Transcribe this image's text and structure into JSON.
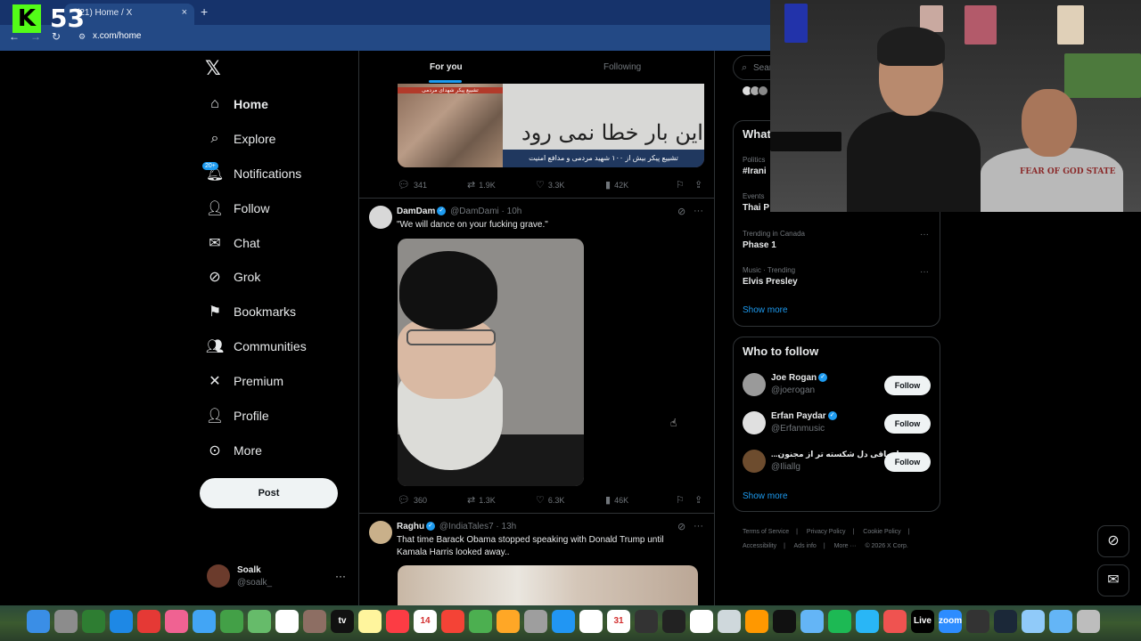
{
  "browser": {
    "tab_title": "(21) Home / X",
    "close": "×",
    "new_tab": "+",
    "url": "x.com/home",
    "back": "←",
    "forward": "→",
    "reload": "↻",
    "site_icon": "⚙"
  },
  "overlay": {
    "kick_logo": "K",
    "viewer_count": "53"
  },
  "sidebar": {
    "logo": "𝕏",
    "items": [
      {
        "label": "Home",
        "icon": "home-icon",
        "glyph": "⌂"
      },
      {
        "label": "Explore",
        "icon": "search-icon",
        "glyph": "⌕"
      },
      {
        "label": "Notifications",
        "icon": "bell-icon",
        "glyph": "🔔︎"
      },
      {
        "label": "Follow",
        "icon": "add-user-icon",
        "glyph": "👤︎"
      },
      {
        "label": "Chat",
        "icon": "mail-icon",
        "glyph": "✉"
      },
      {
        "label": "Grok",
        "icon": "grok-icon",
        "glyph": "⊘"
      },
      {
        "label": "Bookmarks",
        "icon": "bookmark-icon",
        "glyph": "⚑"
      },
      {
        "label": "Communities",
        "icon": "communities-icon",
        "glyph": "👥︎"
      },
      {
        "label": "Premium",
        "icon": "x-icon",
        "glyph": "✕"
      },
      {
        "label": "Profile",
        "icon": "person-icon",
        "glyph": "👤︎"
      },
      {
        "label": "More",
        "icon": "more-circle-icon",
        "glyph": "⊙"
      }
    ],
    "notifications_badge": "20+",
    "post_label": "Post",
    "account": {
      "name": "Soalk",
      "handle": "@soalk_",
      "more": "···"
    }
  },
  "feed": {
    "tab_for_you": "For you",
    "tab_following": "Following",
    "tweet1": {
      "media_sign_text": "این بار خطا نمی رود",
      "media_caption": "تشییع پیکر بیش از ۱۰۰ شهید مردمی و مدافع امنیت",
      "media_small_caption": "تشییع پیکر شهدای مردمی",
      "replies": "341",
      "reposts": "1.9K",
      "likes": "3.3K",
      "views": "42K"
    },
    "tweet2": {
      "name": "DamDam",
      "handle": "@DamDami",
      "time": "· 10h",
      "text": "\"We will dance on your fucking grave.\"",
      "replies": "360",
      "reposts": "1.3K",
      "likes": "6.3K",
      "views": "46K"
    },
    "tweet3": {
      "name": "Raghu",
      "handle": "@IndiaTales7",
      "time": "· 13h",
      "text": "That time Barack Obama stopped speaking with Donald Trump until Kamala Harris looked away.."
    },
    "icons": {
      "reply": "💬︎",
      "repost": "⇄",
      "like": "♡",
      "views": "▮",
      "bookmark": "⚐",
      "share": "⇪",
      "grok": "⊘",
      "more": "···"
    }
  },
  "right": {
    "search_placeholder": "Sear",
    "happening_title": "What",
    "trends": [
      {
        "category": "Politics",
        "name": "#Irani"
      },
      {
        "category": "Events",
        "name": "Thai P"
      },
      {
        "category": "Trending in Canada",
        "name": "Phase 1"
      },
      {
        "category": "Music · Trending",
        "name": "Elvis Presley"
      }
    ],
    "show_more": "Show more",
    "who_to_follow_title": "Who to follow",
    "suggestions": [
      {
        "name": "Joe Rogan",
        "handle": "@joerogan",
        "verified": true
      },
      {
        "name": "Erfan Paydar",
        "handle": "@Erfanmusic",
        "verified": true
      },
      {
        "name": "...ر از باقی دل شکسته تر از مجنون",
        "handle": "@Iliallg",
        "verified": false
      }
    ],
    "follow_label": "Follow",
    "footer": [
      "Terms of Service",
      "|",
      "Privacy Policy",
      "|",
      "Cookie Policy",
      "|",
      "Accessibility",
      "|",
      "Ads info",
      "|",
      "More ···",
      "© 2026 X Corp."
    ]
  },
  "webcam": {
    "shirt_text": "FEAR OF GOD STATE"
  },
  "floating": {
    "grok": "⊘",
    "messages": "✉"
  },
  "dock": [
    {
      "name": "finder",
      "color": "#3a8ee6"
    },
    {
      "name": "launchpad",
      "color": "#8c8c8c"
    },
    {
      "name": "tool",
      "color": "#2e7d32"
    },
    {
      "name": "safari",
      "color": "#1e88e5"
    },
    {
      "name": "chrome",
      "color": "#e53935"
    },
    {
      "name": "photos",
      "color": "#f06292"
    },
    {
      "name": "mail",
      "color": "#42a5f5"
    },
    {
      "name": "facetime",
      "color": "#43a047"
    },
    {
      "name": "messages",
      "color": "#66bb6a"
    },
    {
      "name": "freeform",
      "color": "#ffffff"
    },
    {
      "name": "notes-brown",
      "color": "#8d6e63"
    },
    {
      "name": "tv",
      "color": "#111111"
    },
    {
      "name": "notes",
      "color": "#fff59d"
    },
    {
      "name": "music",
      "color": "#fc3c44"
    },
    {
      "name": "calendar",
      "color": "#ffffff"
    },
    {
      "name": "news",
      "color": "#f44336"
    },
    {
      "name": "numbers",
      "color": "#4caf50"
    },
    {
      "name": "pages",
      "color": "#ffa726"
    },
    {
      "name": "settings",
      "color": "#9e9e9e"
    },
    {
      "name": "appstore",
      "color": "#2196f3"
    },
    {
      "name": "notion",
      "color": "#ffffff"
    },
    {
      "name": "calendar31",
      "color": "#ffffff"
    },
    {
      "name": "logic",
      "color": "#333333"
    },
    {
      "name": "capcut",
      "color": "#222222"
    },
    {
      "name": "unity",
      "color": "#ffffff"
    },
    {
      "name": "silverfish",
      "color": "#cfd8dc"
    },
    {
      "name": "fl-studio",
      "color": "#ff9800"
    },
    {
      "name": "capcut2",
      "color": "#111111"
    },
    {
      "name": "preview",
      "color": "#64b5f6"
    },
    {
      "name": "spotify",
      "color": "#1db954"
    },
    {
      "name": "telegram",
      "color": "#29b6f6"
    },
    {
      "name": "tool2",
      "color": "#ef5350"
    },
    {
      "name": "live",
      "color": "#000000"
    },
    {
      "name": "zoom",
      "color": "#2d8cff"
    },
    {
      "name": "obs",
      "color": "#333333"
    },
    {
      "name": "steam",
      "color": "#1b2838"
    },
    {
      "name": "network",
      "color": "#90caf9"
    },
    {
      "name": "downloads",
      "color": "#64b5f6"
    },
    {
      "name": "trash",
      "color": "#bdbdbd"
    }
  ],
  "dock_labels": {
    "tv": "tv",
    "calendar": "14",
    "calendar31": "31",
    "live": "Live",
    "zoom": "zoom"
  }
}
